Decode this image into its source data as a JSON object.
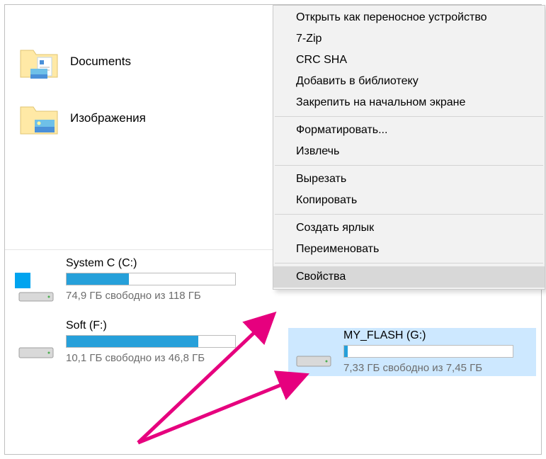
{
  "folders": {
    "documents": {
      "label": "Documents"
    },
    "images": {
      "label": "Изображения"
    }
  },
  "drives": {
    "c": {
      "name": "System C (C:)",
      "free": "74,9 ГБ свободно из 118 ГБ",
      "fill_percent": 37
    },
    "f": {
      "name": "Soft (F:)",
      "free": "10,1 ГБ свободно из 46,8 ГБ",
      "fill_percent": 78
    },
    "g": {
      "name": "MY_FLASH (G:)",
      "free": "7,33 ГБ свободно из 7,45 ГБ",
      "fill_percent": 2
    }
  },
  "context_menu": {
    "open_portable": "Открыть как переносное устройство",
    "seven_zip": "7-Zip",
    "crc_sha": "CRC SHA",
    "add_library": "Добавить в библиотеку",
    "pin_start": "Закрепить на начальном экране",
    "format": "Форматировать...",
    "eject": "Извлечь",
    "cut": "Вырезать",
    "copy": "Копировать",
    "create_shortcut": "Создать ярлык",
    "rename": "Переименовать",
    "properties": "Свойства"
  }
}
